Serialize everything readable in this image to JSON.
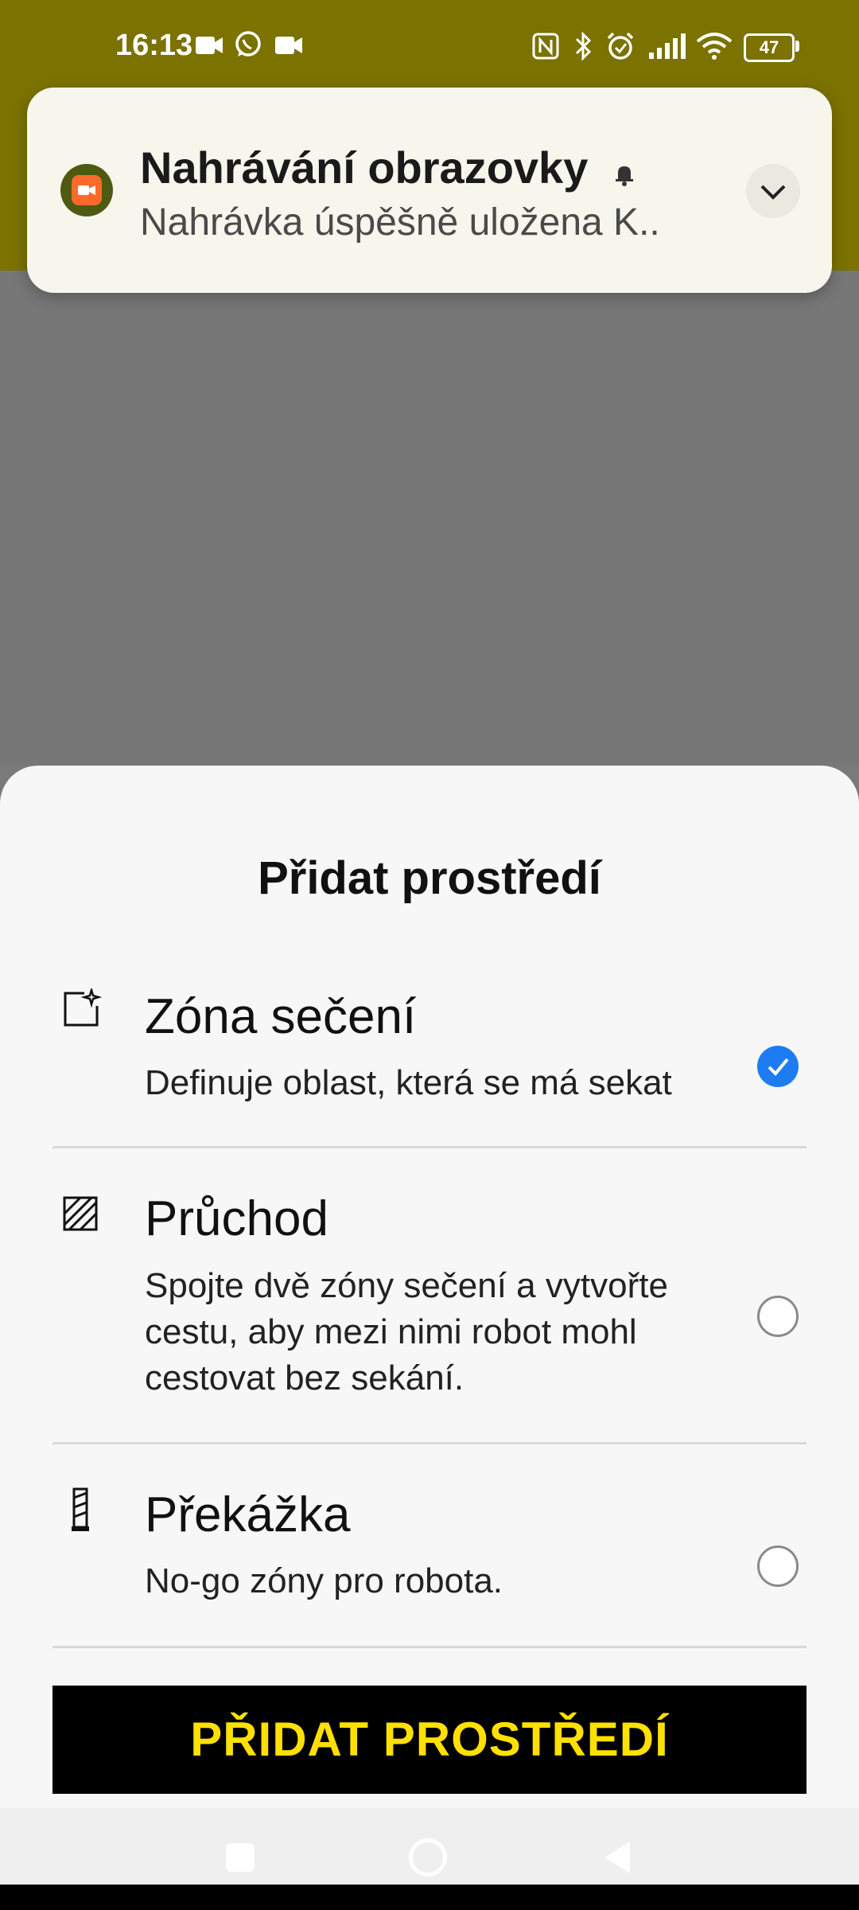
{
  "status_bar": {
    "time": "16:13",
    "battery": "47"
  },
  "notification": {
    "title": "Nahrávání obrazovky",
    "text": "Nahrávka úspěšně uložena K.."
  },
  "sheet": {
    "title": "Přidat prostředí",
    "options": [
      {
        "title": "Zóna sečení",
        "description": "Definuje oblast, která se má sekat",
        "selected": true,
        "icon": "mowing-zone-icon"
      },
      {
        "title": "Průchod",
        "description": "Spojte dvě zóny sečení a vytvořte cestu, aby mezi nimi robot mohl cestovat bez sekání.",
        "selected": false,
        "icon": "passage-icon"
      },
      {
        "title": "Překážka",
        "description": "No-go zóny pro robota.",
        "selected": false,
        "icon": "obstacle-icon"
      }
    ],
    "button_label": "PŘIDAT PROSTŘEDÍ"
  },
  "colors": {
    "header": "#7b7200",
    "accent_blue": "#1e7cf2",
    "button_bg": "#000000",
    "button_text": "#ffe000"
  }
}
